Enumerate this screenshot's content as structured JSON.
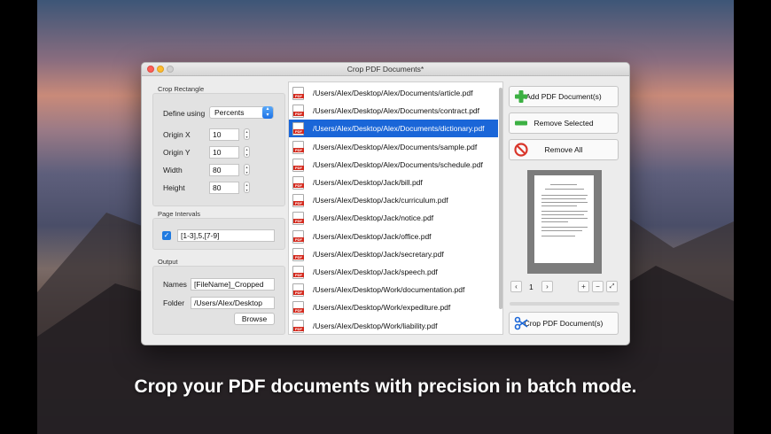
{
  "window": {
    "title": "Crop PDF Documents*"
  },
  "crop_rectangle": {
    "label": "Crop Rectangle",
    "define_using_label": "Define using",
    "define_using_value": "Percents",
    "origin_x_label": "Origin X",
    "origin_x_value": "10",
    "origin_y_label": "Origin Y",
    "origin_y_value": "10",
    "width_label": "Width",
    "width_value": "80",
    "height_label": "Height",
    "height_value": "80"
  },
  "page_intervals": {
    "label": "Page Intervals",
    "enabled": true,
    "value": "[1-3],5,[7-9]"
  },
  "output": {
    "label": "Output",
    "names_label": "Names",
    "names_value": "[FileName]_Cropped",
    "folder_label": "Folder",
    "folder_value": "/Users/Alex/Desktop",
    "browse_label": "Browse"
  },
  "files": [
    "/Users/Alex/Desktop/Alex/Documents/article.pdf",
    "/Users/Alex/Desktop/Alex/Documents/contract.pdf",
    "/Users/Alex/Desktop/Alex/Documents/dictionary.pdf",
    "/Users/Alex/Desktop/Alex/Documents/sample.pdf",
    "/Users/Alex/Desktop/Alex/Documents/schedule.pdf",
    "/Users/Alex/Desktop/Jack/bill.pdf",
    "/Users/Alex/Desktop/Jack/curriculum.pdf",
    "/Users/Alex/Desktop/Jack/notice.pdf",
    "/Users/Alex/Desktop/Jack/office.pdf",
    "/Users/Alex/Desktop/Jack/secretary.pdf",
    "/Users/Alex/Desktop/Jack/speech.pdf",
    "/Users/Alex/Desktop/Work/documentation.pdf",
    "/Users/Alex/Desktop/Work/expediture.pdf",
    "/Users/Alex/Desktop/Work/liability.pdf"
  ],
  "selected_file_index": 2,
  "actions": {
    "add_label": "Add PDF Document(s)",
    "remove_selected_label": "Remove Selected",
    "remove_all_label": "Remove All",
    "crop_label": "Crop PDF Document(s)"
  },
  "preview": {
    "page_number": "1",
    "icons": [
      "chevron-left-icon",
      "chevron-right-icon",
      "zoom-in-icon",
      "zoom-out-icon",
      "fit-icon"
    ]
  },
  "caption": "Crop your PDF documents with precision in batch mode.",
  "colors": {
    "accent": "#1a66d8",
    "add_green": "#3cb043",
    "remove_red": "#d9362b"
  }
}
